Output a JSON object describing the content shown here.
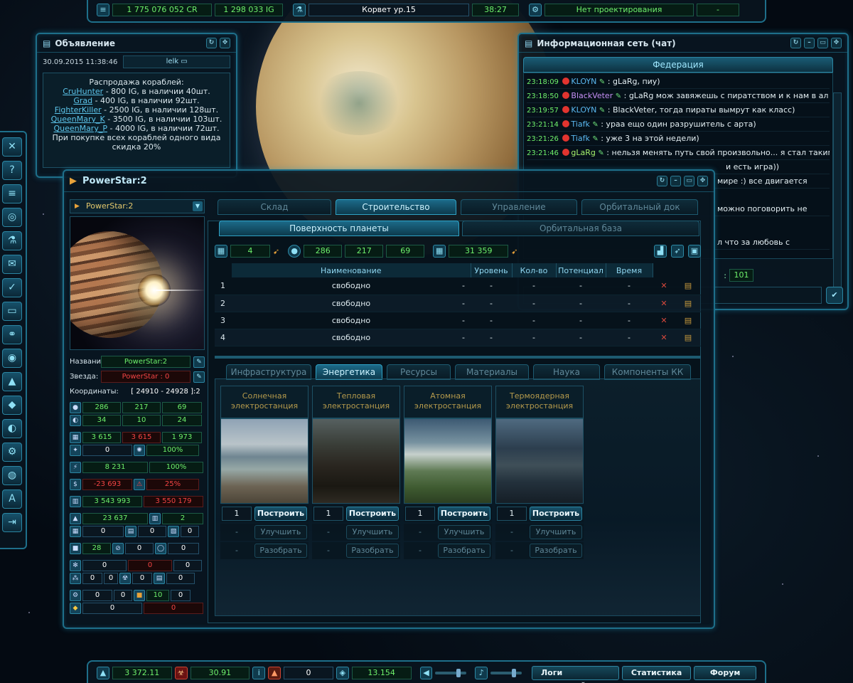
{
  "topbar": {
    "credits": "1 775 076 052 CR",
    "ig": "1 298 033 IG",
    "ship": "Корвет ур.15",
    "time": "38:27",
    "design": "Нет проектирования",
    "design_value": "-"
  },
  "announcement": {
    "title": "Объявление",
    "date": "30.09.2015 11:38:46",
    "author": "lelk",
    "heading": "Распродажа кораблей:",
    "items": [
      {
        "name": "CruHunter",
        "text": " - 800 IG, в наличии 40шт."
      },
      {
        "name": "Grad",
        "text": " - 400 IG, в наличии 92шт."
      },
      {
        "name": "FighterKiller",
        "text": " - 2500 IG, в наличии 128шт."
      },
      {
        "name": "QueenMary_K",
        "text": " - 3500 IG, в наличии 103шт."
      },
      {
        "name": "QueenMary_P",
        "text": " - 4000 IG, в наличии 72шт."
      }
    ],
    "footer": "При покупке всех кораблей одного вида скидка 20%"
  },
  "chat": {
    "title": "Информационная сеть (чат)",
    "tab": "Федерация",
    "messages": [
      {
        "time": "23:18:09",
        "user": "KLOYN",
        "text": ": gLaRg, пиу)"
      },
      {
        "time": "23:18:50",
        "user": "BlackVeter",
        "text": ": gLaRg мож завяжешь с пиратством и к нам в ал ?"
      },
      {
        "time": "23:19:57",
        "user": "KLOYN",
        "text": ": BlackVeter, тогда пираты вымрут как класс)"
      },
      {
        "time": "23:21:14",
        "user": "Tiafk",
        "text": ": ураа ещо один разрушитель с арта)"
      },
      {
        "time": "23:21:26",
        "user": "Tiafk",
        "text": ": уже 3 на этой недели)"
      },
      {
        "time": "23:21:46",
        "user": "gLaRg",
        "text": ": нельзя менять путь свой произвольно... я стал таким"
      }
    ],
    "frag1": "и есть игра))",
    "frag2": "мире :) все двигается",
    "frag3": "можно поговорить не",
    "frag4": "л что за любовь с",
    "count": "101"
  },
  "main": {
    "title": "PowerStar:2",
    "planet_select": "PowerStar:2",
    "name_label": "Название:",
    "name_value": "PowerStar:2",
    "star_label": "Звезда:",
    "star_value": "PowerStar : 0",
    "coords_label": "Координаты:",
    "coords_value": "[ 24910 - 24928 ]:2",
    "main_tabs": [
      "Склад",
      "Строительство",
      "Управление",
      "Орбитальный док"
    ],
    "sub_tabs": [
      "Поверхность планеты",
      "Орбитальная база"
    ],
    "res": {
      "slots": "4",
      "a": "286",
      "b": "217",
      "c": "69",
      "d": "31 359"
    },
    "table": {
      "headers": [
        "Наименование",
        "Уровень",
        "Кол-во",
        "Потенциал",
        "Время"
      ],
      "rows": [
        {
          "n": "1",
          "name": "свободно",
          "dash": "-"
        },
        {
          "n": "2",
          "name": "свободно",
          "dash": "-"
        },
        {
          "n": "3",
          "name": "свободно",
          "dash": "-"
        },
        {
          "n": "4",
          "name": "свободно",
          "dash": "-"
        }
      ]
    },
    "cat_tabs": [
      "Инфраструктура",
      "Энергетика",
      "Ресурсы",
      "Материалы",
      "Наука",
      "Компоненты КК"
    ],
    "cards": [
      {
        "title": "Солнечная электростанция",
        "qty": "1"
      },
      {
        "title": "Тепловая электростанция",
        "qty": "1"
      },
      {
        "title": "Атомная электростанция",
        "qty": "1"
      },
      {
        "title": "Термоядерная электростанция",
        "qty": "1"
      }
    ],
    "build": "Построить",
    "upgrade": "Улучшить",
    "dismantle": "Разобрать",
    "dash": "-",
    "stats": {
      "r1": [
        "286",
        "217",
        "69"
      ],
      "r2": [
        "34",
        "10",
        "24"
      ],
      "r3": [
        "3 615",
        "3 615",
        "1 973"
      ],
      "r4": [
        "0",
        "100%"
      ],
      "r5": [
        "8 231",
        "100%"
      ],
      "r6": [
        "-23 693",
        "25%"
      ],
      "r7": [
        "3 543 993",
        "3 550 179"
      ],
      "r8": [
        "23 637",
        "2"
      ],
      "r9": [
        "0",
        "0",
        "0"
      ],
      "r10": [
        "28",
        "0",
        "0"
      ],
      "r11": [
        "0",
        "0",
        "0"
      ],
      "r12": [
        "0",
        "0",
        "0",
        "0"
      ],
      "r13": [
        "0",
        "0",
        "10",
        "0"
      ],
      "r14": [
        "0",
        "0"
      ]
    }
  },
  "bottombar": {
    "v1": "3 372.11",
    "v2": "30.91",
    "v3": "0",
    "v4": "13.154",
    "battle_logs": "Логи сражений",
    "stats": "Статистика",
    "forum": "Форум"
  }
}
